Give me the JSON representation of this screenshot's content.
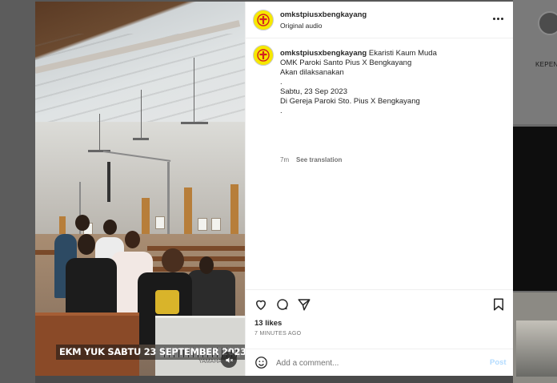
{
  "background": {
    "side_label": "KEPENG"
  },
  "media": {
    "caption": "EKM YUK SABTU 23 SEPTEMBER 2023",
    "brand_mark": "YAMAHA",
    "mute_icon": "speaker-muted-icon"
  },
  "header": {
    "username": "omkstpiusxbengkayang",
    "subtitle": "Original audio",
    "more_icon": "more-horizontal-icon"
  },
  "caption": {
    "username": "omkstpiusxbengkayang",
    "first_line": "Ekaristi Kaum Muda",
    "lines": [
      "OMK Paroki Santo Pius X Bengkayang",
      "Akan dilaksanakan",
      ".",
      "Sabtu, 23 Sep 2023",
      "Di Gereja Paroki Sto. Pius X Bengkayang",
      "."
    ],
    "age": "7m",
    "translate_label": "See translation"
  },
  "actions": {
    "icons": [
      "heart-icon",
      "comment-icon",
      "share-icon",
      "bookmark-icon"
    ],
    "likes": "13 likes",
    "time_ago": "7 MINUTES AGO"
  },
  "comment_box": {
    "placeholder": "Add a comment...",
    "post_label": "Post"
  },
  "colors": {
    "avatar_bg": "#f6e800",
    "post_button": "#b3dbff",
    "text_primary": "#262626",
    "text_secondary": "#737373"
  }
}
